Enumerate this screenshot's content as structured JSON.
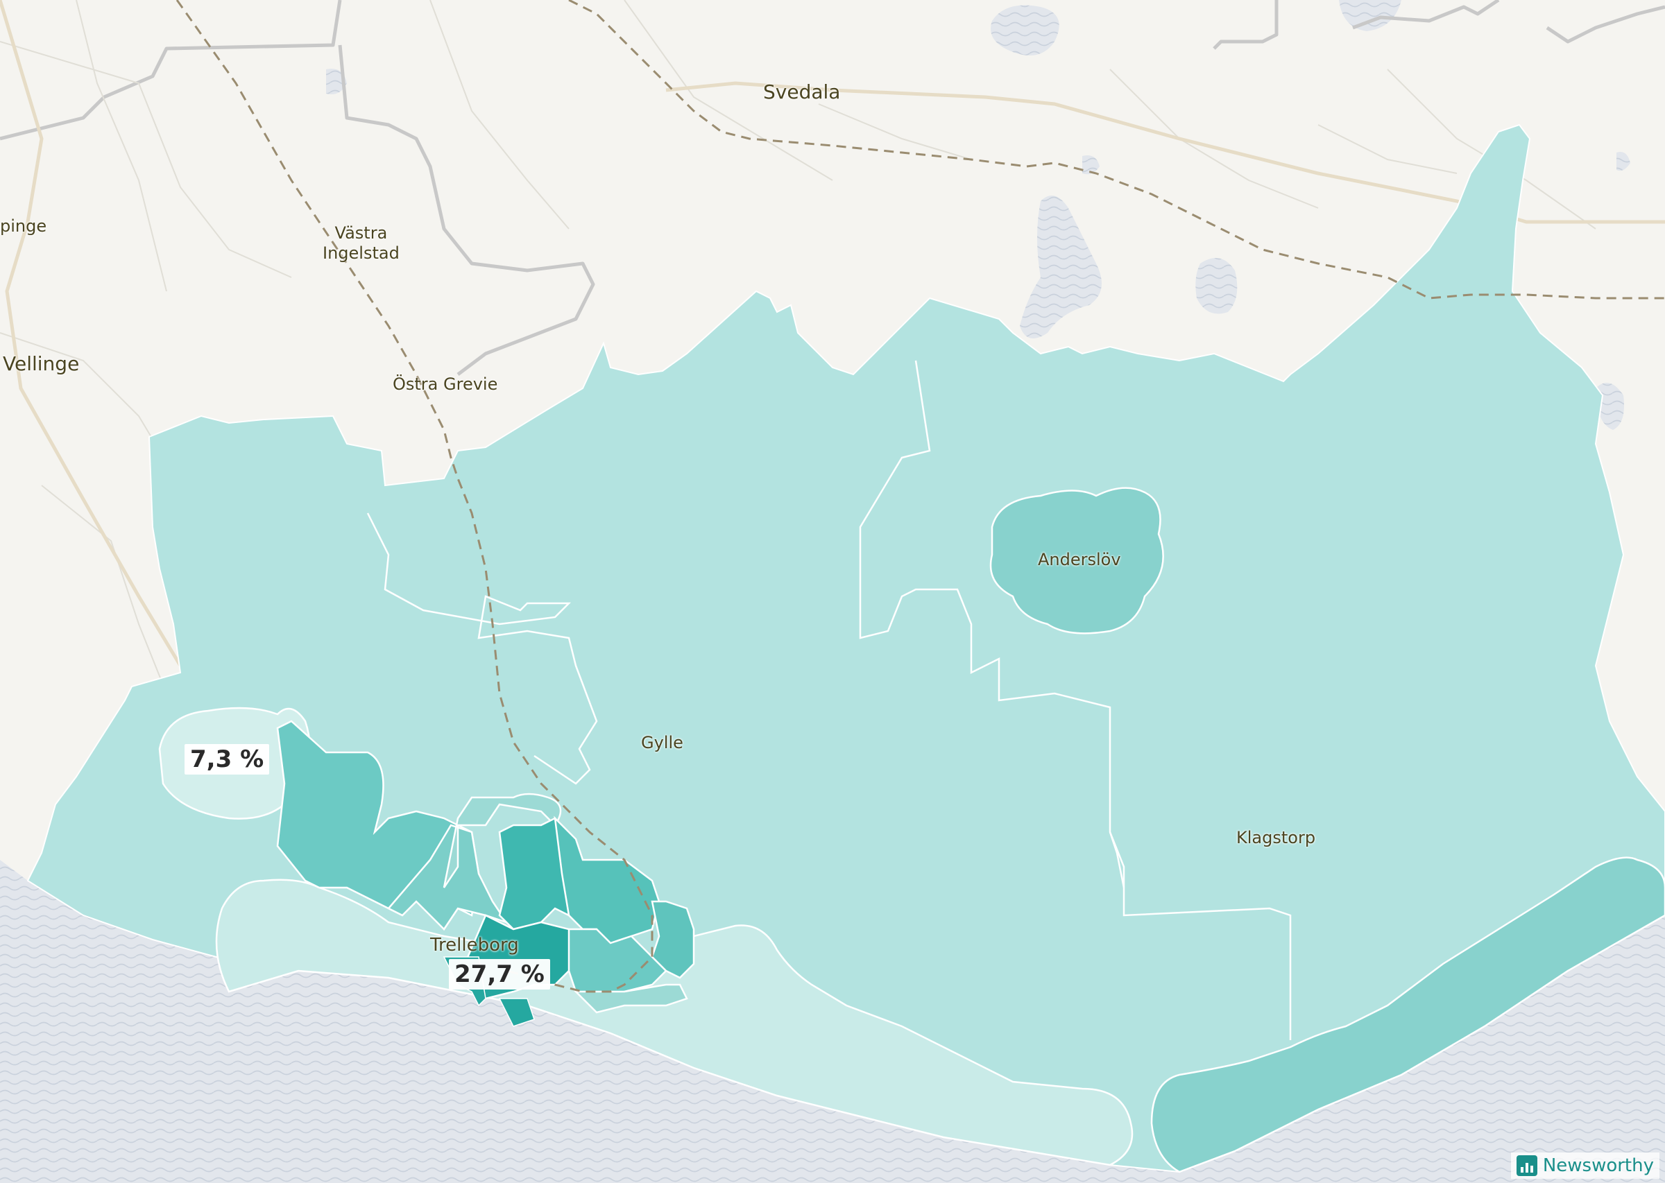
{
  "map": {
    "places": [
      {
        "id": "svedala",
        "label": "Svedala"
      },
      {
        "id": "vastra-ingelstad",
        "label": "Västra\nIngelstad"
      },
      {
        "id": "vellinge",
        "label": "Vellinge"
      },
      {
        "id": "pinge",
        "label": "pinge"
      },
      {
        "id": "ostra-grevie",
        "label": "Östra Grevie"
      },
      {
        "id": "anderslov",
        "label": "Anderslöv"
      },
      {
        "id": "gylle",
        "label": "Gylle"
      },
      {
        "id": "klagstorp",
        "label": "Klagstorp"
      },
      {
        "id": "trelleborg",
        "label": "Trelleborg"
      }
    ],
    "value_labels": {
      "low": "7,3 %",
      "high": "27,7 %"
    },
    "colors": {
      "land": "#f5f4f0",
      "water": "#dde3ea",
      "region_base": "#b3e3e0",
      "region_light": "#d3efec",
      "region_mid": "#88d2cd",
      "region_dark": "#4fbfb7",
      "region_darkest": "#25a8a0",
      "roads": "#c4c4c4",
      "railway": "#9a8c70"
    },
    "attribution": {
      "brand": "Newsworthy",
      "icon": "bar-chart-icon"
    }
  }
}
